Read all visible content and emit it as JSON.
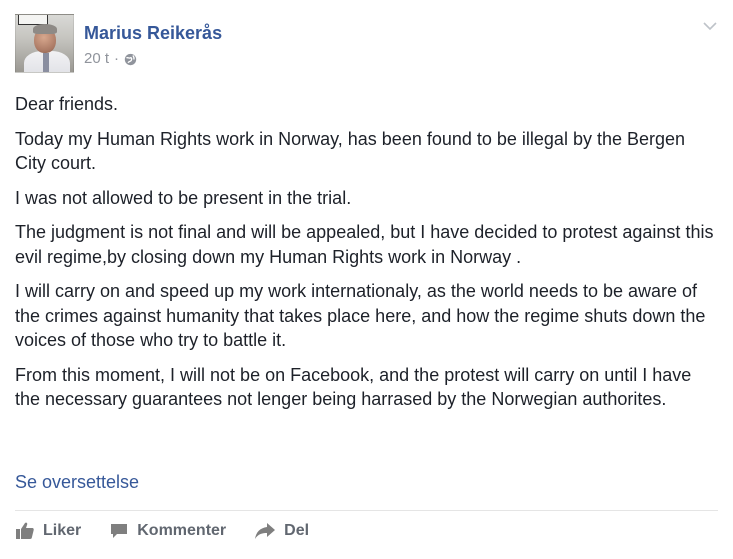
{
  "post": {
    "author": "Marius Reikerås",
    "time": "20 t",
    "separator": "·",
    "privacy_icon": "globe-icon",
    "paragraphs": [
      "Dear friends.",
      "Today my Human Rights work in Norway, has been found to be illegal by the Bergen City court.",
      "I was not allowed to be present in the trial.",
      "The judgment is not final and will be appealed, but I have decided to protest against this evil regime,by closing down my Human Rights work in Norway .",
      "I will carry on and speed up my work internationaly, as the world needs to be aware of the crimes against humanity that takes place here, and how the regime shuts down the voices of those who try to battle it.",
      "From this moment, I will not be on Facebook, and the protest will carry on until I have the necessary guarantees not lenger being harrased by the Norwegian authorites."
    ],
    "translate_link": "Se oversettelse"
  },
  "actions": {
    "like_label": "Liker",
    "comment_label": "Kommenter",
    "share_label": "Del"
  },
  "colors": {
    "link": "#365899",
    "text": "#1d2129",
    "meta": "#90949c",
    "action": "#616770"
  }
}
